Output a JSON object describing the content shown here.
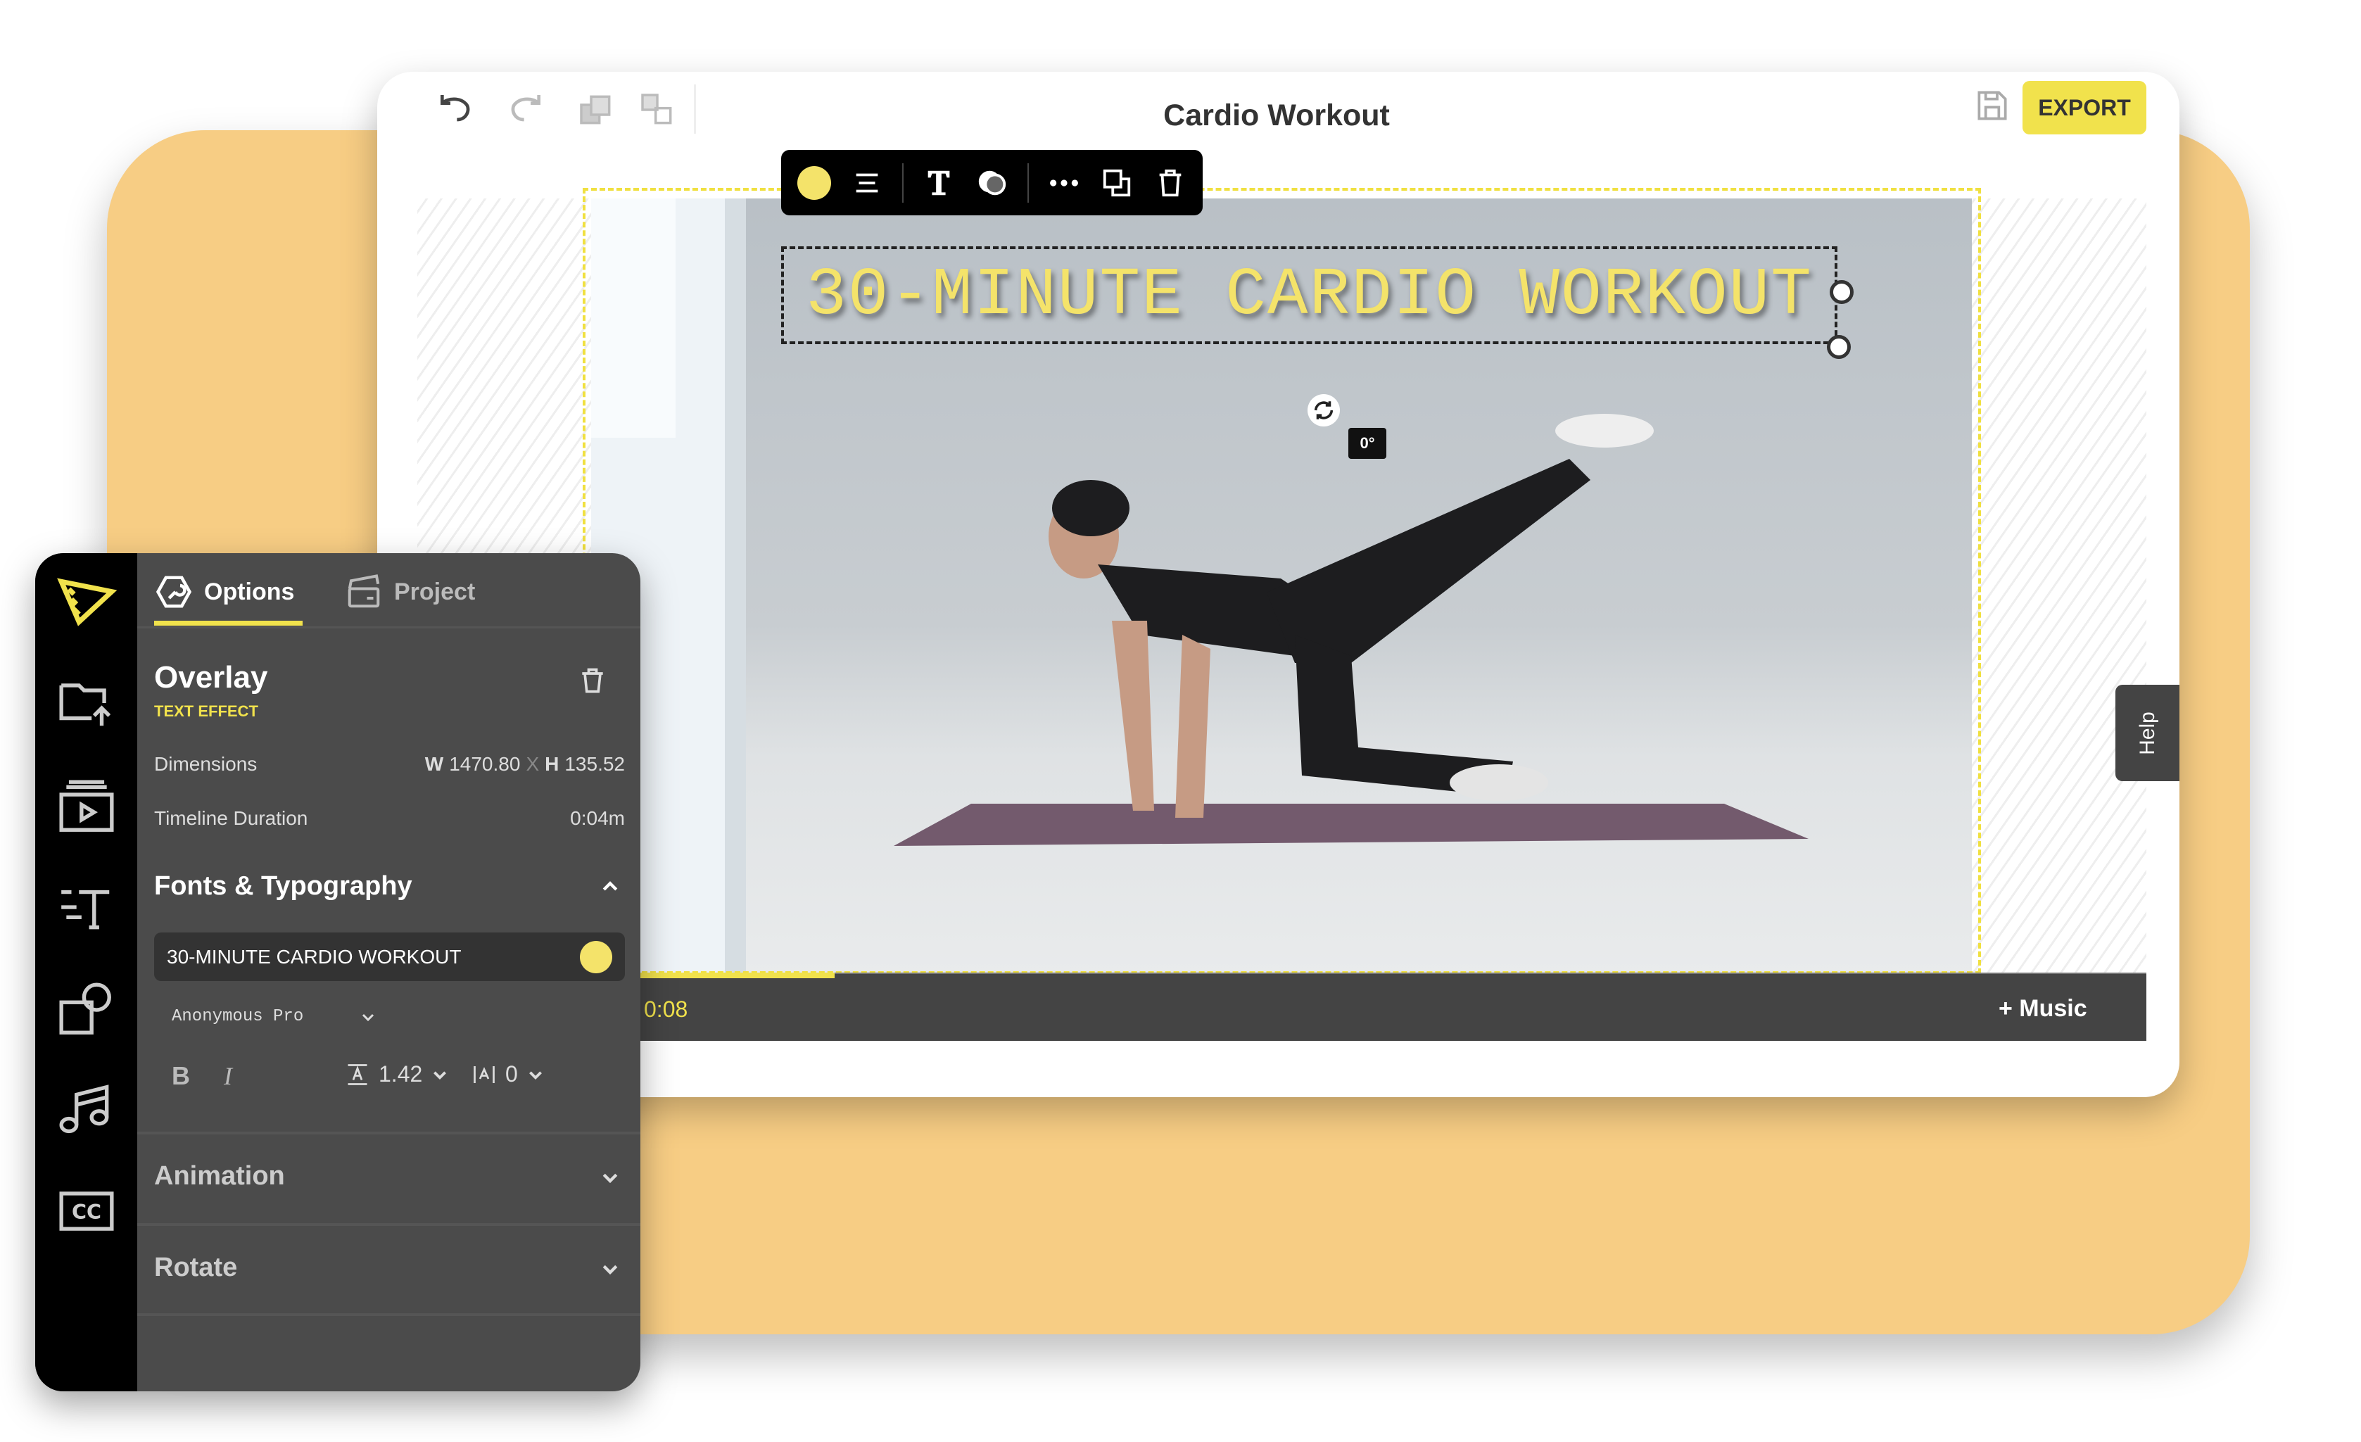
{
  "colors": {
    "accent": "#f1e24c",
    "backdrop": "#f7cd84",
    "panel": "#4b4b4b",
    "sidebar": "#000000"
  },
  "header": {
    "title": "Cardio Workout",
    "export_label": "EXPORT",
    "icons": [
      "undo-icon",
      "redo-icon",
      "bring-forward-icon",
      "send-backward-icon",
      "save-icon"
    ]
  },
  "floating_toolbar": {
    "icons": [
      "color-swatch-icon",
      "align-icon",
      "text-style-icon",
      "effects-icon",
      "more-icon",
      "duplicate-icon",
      "delete-icon"
    ],
    "color": "#f4e36a"
  },
  "canvas": {
    "overlay_text": "30-MINUTE CARDIO WORKOUT",
    "rotation_label": "0°"
  },
  "timeline": {
    "current_time": "0:08",
    "progress_fraction": 0.13,
    "music_label": "+ Music"
  },
  "help_label": "Help",
  "panel": {
    "tabs": [
      {
        "label": "Options",
        "active": true
      },
      {
        "label": "Project",
        "active": false
      }
    ],
    "overlay_title": "Overlay",
    "overlay_type": "TEXT EFFECT",
    "dimensions_label": "Dimensions",
    "dim_w_label": "W",
    "dim_w": "1470.80",
    "dim_x": "X",
    "dim_h_label": "H",
    "dim_h": "135.52",
    "duration_label": "Timeline Duration",
    "duration_value": "0:04m",
    "fonts_section": "Fonts & Typography",
    "text_value": "30-MINUTE CARDIO WORKOUT",
    "font_family": "Anonymous Pro",
    "bold": "B",
    "italic": "I",
    "line_height": "1.42",
    "letter_spacing": "0",
    "animation_section": "Animation",
    "rotate_section": "Rotate"
  },
  "sidebar_icons": [
    "logo-icon",
    "upload-folder-icon",
    "media-icon",
    "text-icon",
    "shapes-icon",
    "music-icon",
    "captions-icon"
  ]
}
